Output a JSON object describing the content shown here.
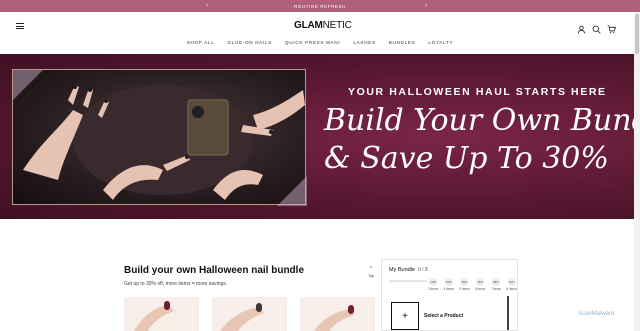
{
  "announcement": {
    "text": "ROUTINE REFRESH",
    "prev_icon": "chevron-left-icon",
    "next_icon": "chevron-right-icon"
  },
  "header": {
    "logo_bold": "GLAM",
    "logo_rest": "NETIC",
    "menu_icon": "hamburger-menu-icon",
    "icons": [
      "account-icon",
      "search-icon",
      "cart-icon"
    ]
  },
  "nav": {
    "items": [
      "SHOP ALL",
      "GLUE-ON NAILS",
      "QUICK PRESS MANI",
      "LASHES",
      "BUNDLES",
      "LOYALTY"
    ]
  },
  "hero": {
    "tagline": "YOUR HALLOWEEN HAUL STARTS HERE",
    "headline_1": "Build Your Own Bundle",
    "headline_2": "& Save Up To 30%"
  },
  "bundle": {
    "title": "Build your own Halloween nail bundle",
    "subtitle": "Get up to 30% off, more items = more savings.",
    "top_label": "Top"
  },
  "panel": {
    "title": "My Bundle",
    "count": "0 / 8",
    "progress_fraction": 0,
    "steps": [
      {
        "badge": "10%",
        "label": "3 items"
      },
      {
        "badge": "15%",
        "label": "4 items"
      },
      {
        "badge": "20%",
        "label": "5 items"
      },
      {
        "badge": "25%",
        "label": "6 items"
      },
      {
        "badge": "28%",
        "label": "7 items"
      },
      {
        "badge": "30%",
        "label": "8 items"
      }
    ],
    "add_symbol": "+",
    "select_label": "Select a Product"
  },
  "watermark": "ScanMalware",
  "colors": {
    "announcement_bg": "#b06079",
    "hero_bg": "#55172f",
    "product_bg": "#f7eee9"
  }
}
